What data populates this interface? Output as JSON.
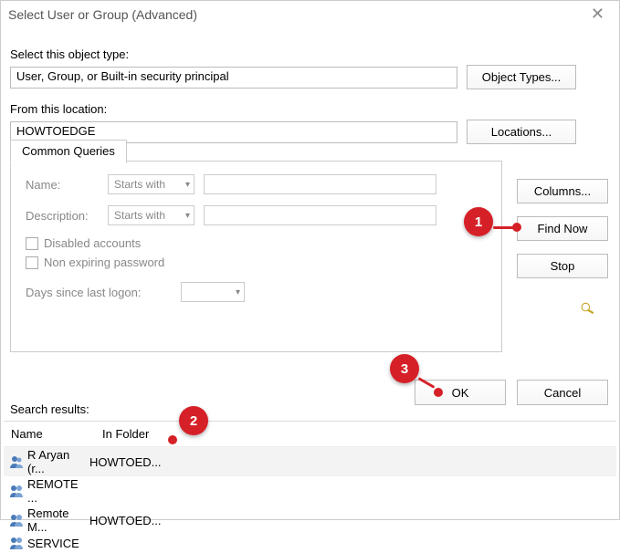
{
  "dialog": {
    "title": "Select User or Group (Advanced)",
    "close_glyph": "✕"
  },
  "object_type": {
    "label": "Select this object type:",
    "value": "User, Group, or Built-in security principal",
    "button": "Object Types..."
  },
  "location": {
    "label": "From this location:",
    "value": "HOWTOEDGE",
    "button": "Locations..."
  },
  "tab": {
    "label": "Common Queries"
  },
  "queries": {
    "name_label": "Name:",
    "name_combo": "Starts with",
    "desc_label": "Description:",
    "desc_combo": "Starts with",
    "disabled_label": "Disabled accounts",
    "nonexp_label": "Non expiring password",
    "days_label": "Days since last logon:"
  },
  "right_buttons": {
    "columns": "Columns...",
    "find_now": "Find Now",
    "stop": "Stop"
  },
  "bottom": {
    "ok": "OK",
    "cancel": "Cancel"
  },
  "search": {
    "label": "Search results:",
    "columns": {
      "name": "Name",
      "folder": "In Folder"
    },
    "rows": [
      {
        "name": "R Aryan (r...",
        "folder": "HOWTOED...",
        "selected": true,
        "kind": "user"
      },
      {
        "name": "REMOTE ...",
        "folder": "",
        "selected": false,
        "kind": "group"
      },
      {
        "name": "Remote M...",
        "folder": "HOWTOED...",
        "selected": false,
        "kind": "group"
      },
      {
        "name": "SERVICE",
        "folder": "",
        "selected": false,
        "kind": "group"
      }
    ]
  },
  "annotations": {
    "a1": "1",
    "a2": "2",
    "a3": "3"
  }
}
